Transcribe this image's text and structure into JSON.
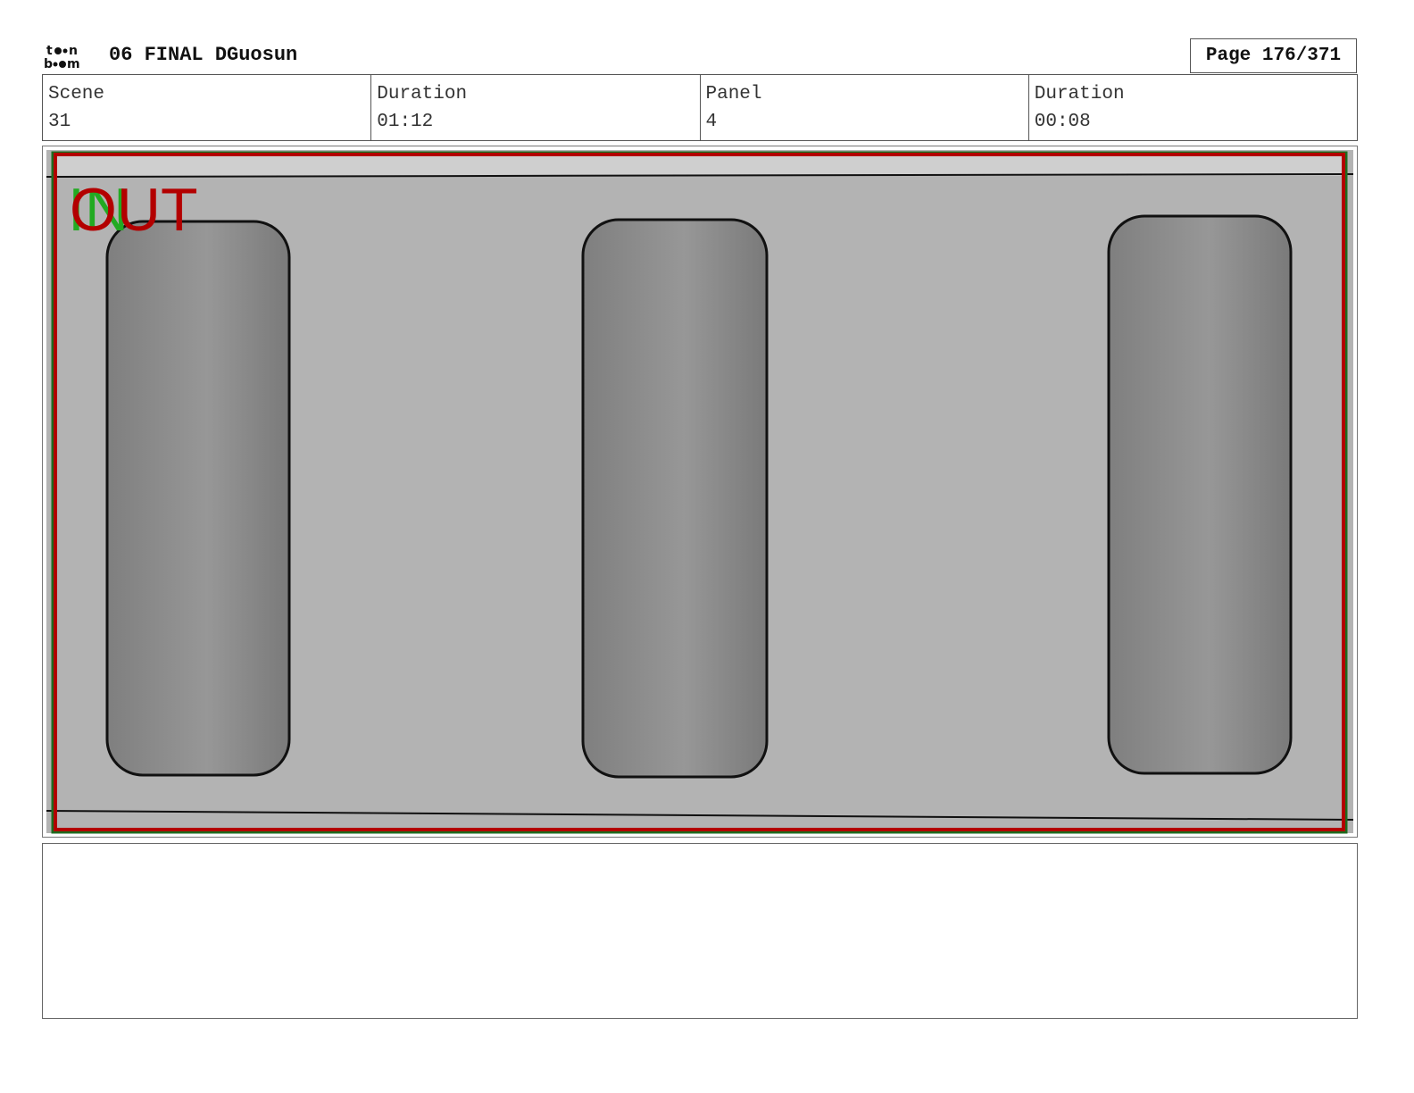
{
  "header": {
    "logo": "toon boom",
    "project_title": "06 FINAL DGuosun",
    "page_label": "Page 176/371"
  },
  "info": [
    {
      "label": "Scene",
      "value": "31"
    },
    {
      "label": "Duration",
      "value": "01:12"
    },
    {
      "label": "Panel",
      "value": "4"
    },
    {
      "label": "Duration",
      "value": "00:08"
    }
  ],
  "panel": {
    "in_marker": "IN",
    "out_marker": "OUT",
    "colors": {
      "frame": "#b30000",
      "in": "#22aa22",
      "background": "#b3b3b3",
      "cylinder": "#8a8a8a"
    }
  },
  "notes": {}
}
